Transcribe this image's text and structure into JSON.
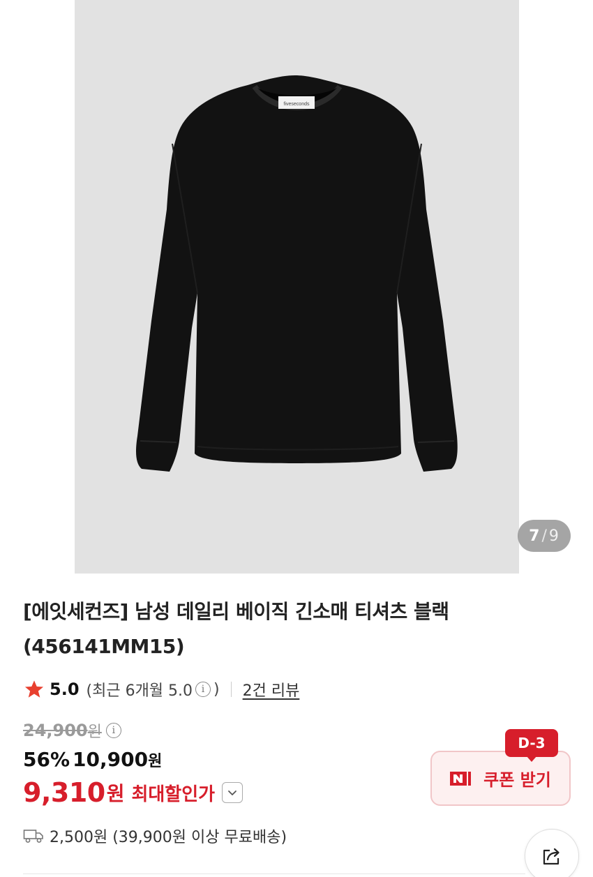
{
  "gallery": {
    "current": "7",
    "separator": "/",
    "total": "9",
    "background": "#e2e2e2",
    "product_label_text": "fiveseconds"
  },
  "product": {
    "title_line1": "[에잇세컨즈] 남성 데일리 베이직 긴소매 티셔츠 블랙",
    "title_line2": "(456141MM15)"
  },
  "rating": {
    "star_icon": "star-icon",
    "score": "5.0",
    "recent_prefix": "(최근 6개월 5.0",
    "recent_info": "i",
    "recent_suffix": ")",
    "reviews_link": "2건 리뷰"
  },
  "pricing": {
    "original_price": "24,900",
    "original_unit": "원",
    "original_info": "i",
    "discount_pct": "56%",
    "sale_price": "10,900",
    "sale_unit": "원",
    "final_price": "9,310",
    "final_unit": "원",
    "final_label": "최대할인가",
    "accent_color": "#d71e2b"
  },
  "coupon": {
    "dday": "D-3",
    "label": "쿠폰 받기",
    "icon": "naver-n-icon"
  },
  "shipping": {
    "icon": "truck-icon",
    "text": "2,500원 (39,900원 이상 무료배송)"
  },
  "share": {
    "icon": "share-icon"
  }
}
